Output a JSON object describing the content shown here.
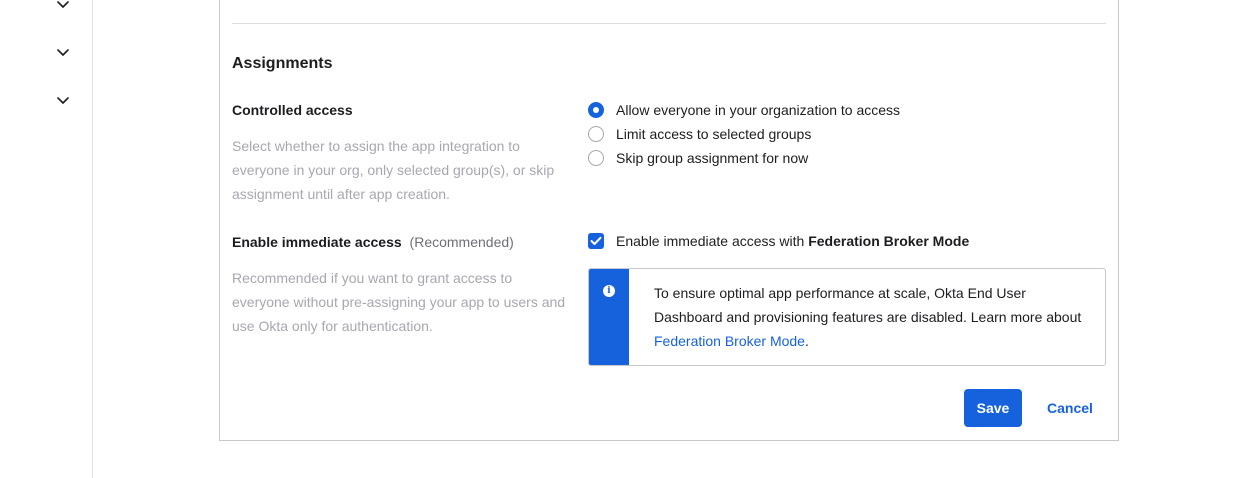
{
  "nav": {
    "chevrons": [
      "chevron-down-icon",
      "chevron-down-icon",
      "chevron-down-icon"
    ]
  },
  "assignments": {
    "title": "Assignments",
    "controlled_access": {
      "label": "Controlled access",
      "help": "Select whether to assign the app integration to everyone in your org, only selected group(s), or skip assignment until after app creation.",
      "options": [
        {
          "label": "Allow everyone in your organization to access",
          "checked": true
        },
        {
          "label": "Limit access to selected groups",
          "checked": false
        },
        {
          "label": "Skip group assignment for now",
          "checked": false
        }
      ]
    },
    "immediate_access": {
      "label": "Enable immediate access",
      "recommended": "(Recommended)",
      "help": "Recommended if you want to grant access to everyone without pre-assigning your app to users and use Okta only for authentication.",
      "checkbox_prefix": "Enable immediate access with ",
      "checkbox_bold": "Federation Broker Mode",
      "checked": true,
      "callout": {
        "icon": "info-icon",
        "text_before": "To ensure optimal app performance at scale, Okta End User Dashboard and provisioning features are disabled. Learn more about ",
        "link": "Federation Broker Mode",
        "text_after": "."
      }
    }
  },
  "actions": {
    "save": "Save",
    "cancel": "Cancel"
  },
  "colors": {
    "primary": "#1662dd",
    "help_text": "#a7a7b0",
    "border": "#c7c7cc"
  }
}
